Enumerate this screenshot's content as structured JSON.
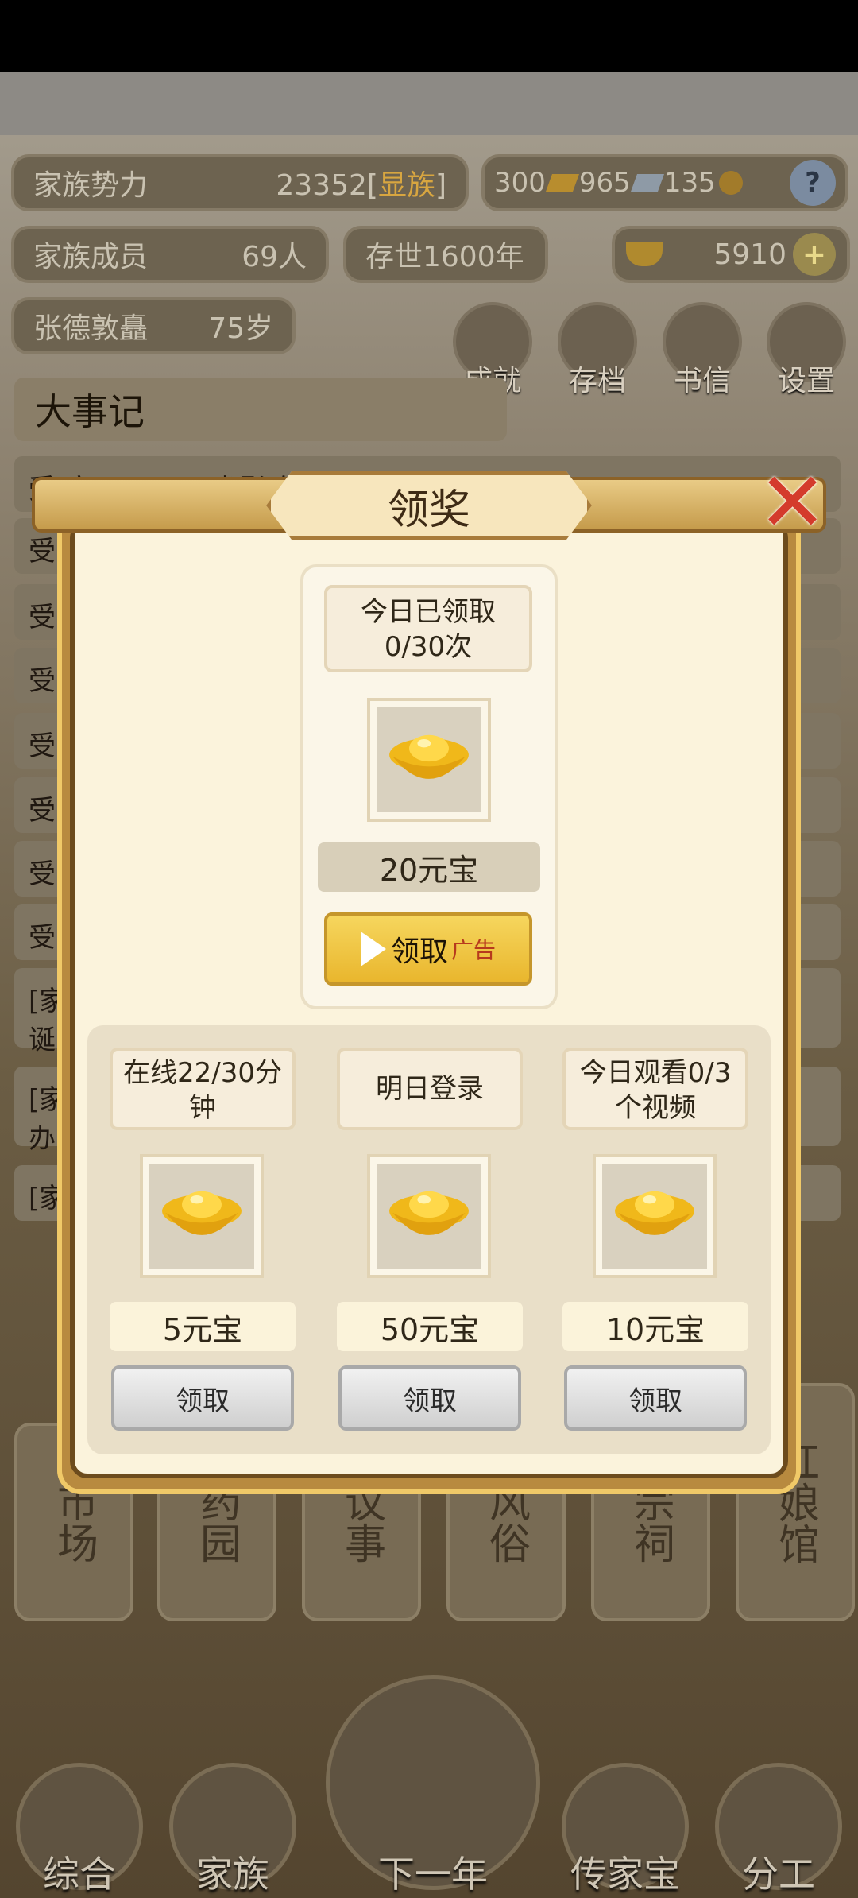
{
  "hud": {
    "clan_power_label": "家族势力",
    "clan_power_value": "23352",
    "clan_power_bracket_open": "[",
    "clan_power_tag": "显族",
    "clan_power_bracket_close": "]",
    "gold_bars": "300",
    "silver_bars": "965",
    "coins": "135",
    "help": "?",
    "members_label": "家族成员",
    "members_value": "69人",
    "years": "存世1600年",
    "yuanbao": "5910",
    "add": "+",
    "patriarch_name": "张德敦矗",
    "patriarch_age": "75岁"
  },
  "quick_buttons": [
    "成就",
    "存档",
    "书信",
    "设置"
  ],
  "events": {
    "title": "大事记",
    "rows": [
      "受[家风]一日三省影响，……]天资+10",
      "受",
      "受",
      "受",
      "受",
      "受",
      "受",
      "受",
      "[家",
      "诞",
      "[家",
      "办",
      "[家"
    ]
  },
  "side_tiles": [
    "市场",
    "药园",
    "议事",
    "风俗",
    "宗祠",
    "红娘馆"
  ],
  "nav": [
    "综合",
    "家族",
    "下一年",
    "传家宝",
    "分工"
  ],
  "modal": {
    "title": "领奖",
    "close": "✕",
    "main": {
      "info_line1": "今日已领取",
      "info_line2": "0/30次",
      "amount": "20元宝",
      "button": "领取",
      "button_tag": "广告"
    },
    "rewards": [
      {
        "info_line1": "在线22/30分",
        "info_line2": "钟",
        "amount": "5元宝",
        "button": "领取"
      },
      {
        "info_line1": "明日登录",
        "info_line2": "",
        "amount": "50元宝",
        "button": "领取"
      },
      {
        "info_line1": "今日观看0/3",
        "info_line2": "个视频",
        "amount": "10元宝",
        "button": "领取"
      }
    ]
  },
  "colors": {
    "accent_gold": "#e9b62d",
    "close_red": "#d43b2c",
    "panel_cream": "#fbf3dc"
  }
}
